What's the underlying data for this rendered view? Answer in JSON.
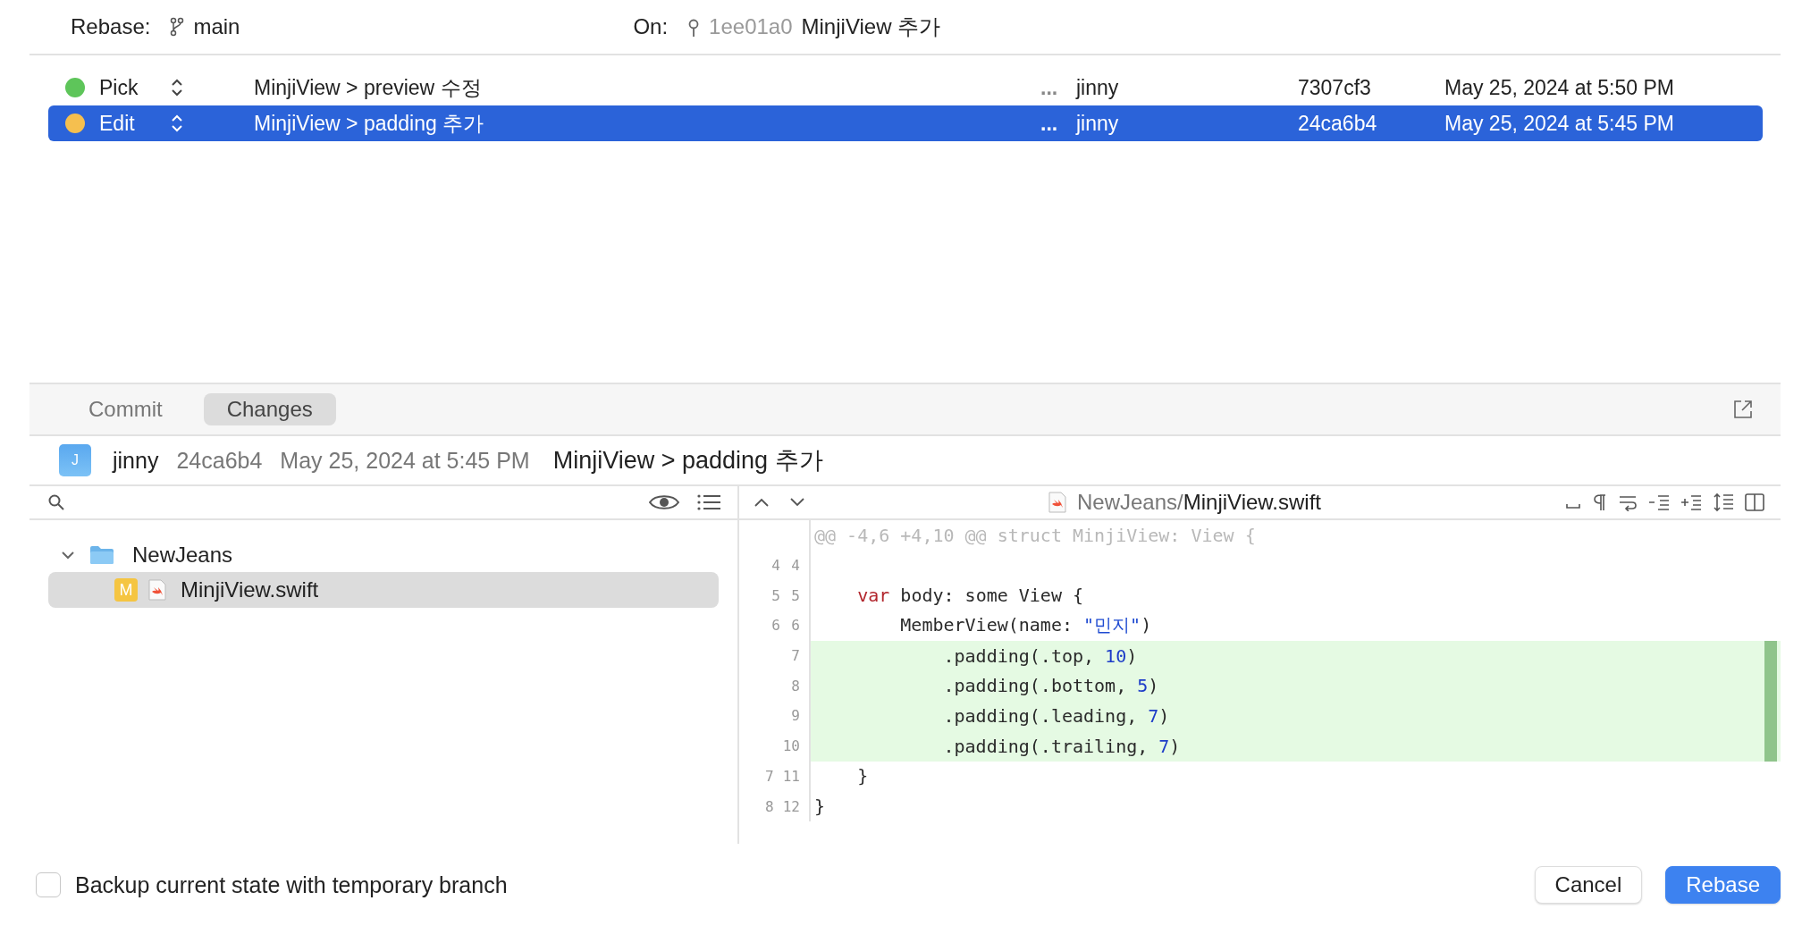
{
  "header": {
    "rebase_label": "Rebase:",
    "branch": "main",
    "on_label": "On:",
    "base_hash": "1ee01a0",
    "base_message": "MinjiView 추가"
  },
  "commits": [
    {
      "action": "Pick",
      "color": "#5ec55a",
      "message": "MinjiView > preview 수정",
      "more": "...",
      "author": "jinny",
      "hash": "7307cf3",
      "date": "May 25, 2024 at 5:50 PM",
      "selected": false
    },
    {
      "action": "Edit",
      "color": "#f5bf4f",
      "message": "MinjiView > padding 추가",
      "more": "...",
      "author": "jinny",
      "hash": "24ca6b4",
      "date": "May 25, 2024 at 5:45 PM",
      "selected": true
    }
  ],
  "tabs": [
    {
      "label": "Commit",
      "selected": false
    },
    {
      "label": "Changes",
      "selected": true
    }
  ],
  "commit_info": {
    "avatar": "J",
    "author": "jinny",
    "hash": "24ca6b4",
    "date": "May 25, 2024 at 5:45 PM",
    "message": "MinjiView > padding 추가"
  },
  "file_tree": [
    {
      "name": "NewJeans",
      "expanded": true,
      "children": [
        {
          "name": "MinjiView.swift",
          "status": "M",
          "selected": true
        }
      ]
    }
  ],
  "diff": {
    "path_dir": "NewJeans/",
    "path_file": "MinjiView.swift",
    "lines": [
      {
        "kind": "hunk",
        "segments": [
          {
            "text": "@@ -4,6 +4,10 @@ struct MinjiView: View {",
            "kind": "meta"
          }
        ]
      },
      {
        "kind": "context",
        "old": "4",
        "new": "4"
      },
      {
        "kind": "context",
        "old": "5",
        "new": "5",
        "segments": [
          {
            "text": "    var",
            "kind": "keyword"
          },
          {
            "text": " body: some View {",
            "kind": "plain"
          }
        ]
      },
      {
        "kind": "context",
        "old": "6",
        "new": "6",
        "segments": [
          {
            "text": "        MemberView(name: ",
            "kind": "plain"
          },
          {
            "text": "\"민지\"",
            "kind": "string"
          },
          {
            "text": ")",
            "kind": "plain"
          }
        ]
      },
      {
        "kind": "added",
        "new": "7",
        "segments": [
          {
            "text": "            .padding(.top, ",
            "kind": "plain"
          },
          {
            "text": "10",
            "kind": "number"
          },
          {
            "text": ")",
            "kind": "plain"
          }
        ]
      },
      {
        "kind": "added",
        "new": "8",
        "segments": [
          {
            "text": "            .padding(.bottom, ",
            "kind": "plain"
          },
          {
            "text": "5",
            "kind": "number"
          },
          {
            "text": ")",
            "kind": "plain"
          }
        ]
      },
      {
        "kind": "added",
        "new": "9",
        "segments": [
          {
            "text": "            .padding(.leading, ",
            "kind": "plain"
          },
          {
            "text": "7",
            "kind": "number"
          },
          {
            "text": ")",
            "kind": "plain"
          }
        ]
      },
      {
        "kind": "added",
        "new": "10",
        "segments": [
          {
            "text": "            .padding(.trailing, ",
            "kind": "plain"
          },
          {
            "text": "7",
            "kind": "number"
          },
          {
            "text": ")",
            "kind": "plain"
          }
        ]
      },
      {
        "kind": "context",
        "old": "7",
        "new": "11",
        "segments": [
          {
            "text": "    }",
            "kind": "plain"
          }
        ]
      },
      {
        "kind": "context",
        "old": "8",
        "new": "12",
        "segments": [
          {
            "text": "}",
            "kind": "plain"
          }
        ]
      }
    ]
  },
  "backup": {
    "label": "Backup current state with temporary branch",
    "checked": false
  },
  "buttons": [
    {
      "label": "Cancel",
      "kind": "secondary"
    },
    {
      "label": "Rebase",
      "kind": "primary"
    }
  ]
}
